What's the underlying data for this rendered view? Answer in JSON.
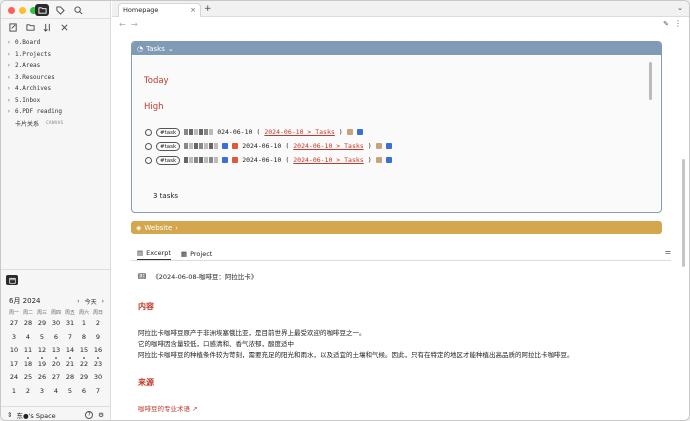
{
  "sidebar": {
    "tree": [
      {
        "label": "0.Board",
        "chevron": "›"
      },
      {
        "label": "1.Projects",
        "chevron": "›"
      },
      {
        "label": "2.Areas",
        "chevron": "›"
      },
      {
        "label": "3.Resources",
        "chevron": "›"
      },
      {
        "label": "4.Archives",
        "chevron": "›"
      },
      {
        "label": "5.Inbox",
        "chevron": "›"
      },
      {
        "label": "6.PDF reading",
        "chevron": "›"
      },
      {
        "label": "卡片关系",
        "tag": "CANVAS"
      }
    ],
    "calendar": {
      "month": "6月 2024",
      "today_label": "今天",
      "weekdays": [
        "周一",
        "周二",
        "周三",
        "周四",
        "周五",
        "周六",
        "周日"
      ],
      "days": [
        "27",
        "28",
        "29",
        "30",
        "31",
        "1",
        "2",
        "3",
        "4",
        "5",
        "6",
        "7",
        "8",
        "9",
        "10",
        "11",
        "12",
        "13",
        "14",
        "15",
        "16",
        "17",
        "18",
        "19",
        "20",
        "21",
        "22",
        "23",
        "24",
        "25",
        "26",
        "27",
        "28",
        "29",
        "30",
        "1",
        "2",
        "3",
        "4",
        "5",
        "6",
        "7"
      ]
    },
    "footer": {
      "space_label": "东●'s Space"
    }
  },
  "tabs": {
    "active_label": "Homepage",
    "close_glyph": "×",
    "add_glyph": "+"
  },
  "tasks": {
    "header": "Tasks",
    "heading_today": "Today",
    "heading_priority": "High",
    "rows": [
      {
        "tag": "#task",
        "date": "024-06-10",
        "link": "2024-06-10 > Tasks"
      },
      {
        "tag": "#task",
        "date": "2024-06-10",
        "link": "2024-06-10 > Tasks"
      },
      {
        "tag": "#task",
        "date": "2024-06-10",
        "link": "2024-06-10 > Tasks"
      }
    ],
    "count": "3 tasks"
  },
  "website": {
    "label": "Website"
  },
  "subtabs": [
    {
      "label": "Excerpt"
    },
    {
      "label": "Project"
    }
  ],
  "document": {
    "title": "《2024-06-08-咖啡豆：阿拉比卡》",
    "section1": "内容",
    "paragraph_lines": [
      "阿拉比卡咖啡豆原产于非洲埃塞俄比亚，是目前世界上最受欢迎的咖啡豆之一。",
      "它的咖啡因含量较低，口感清和、香气浓郁，酸度适中",
      "阿拉比卡咖啡豆的种植条件较为苛刻，需要充足的阳光和雨水，以及适宜的土壤和气候。因此，只有在特定的地区才能种植出高品质的阿拉比卡咖啡豆。"
    ],
    "section2": "来源",
    "source_link": "咖啡豆的专业术语"
  }
}
